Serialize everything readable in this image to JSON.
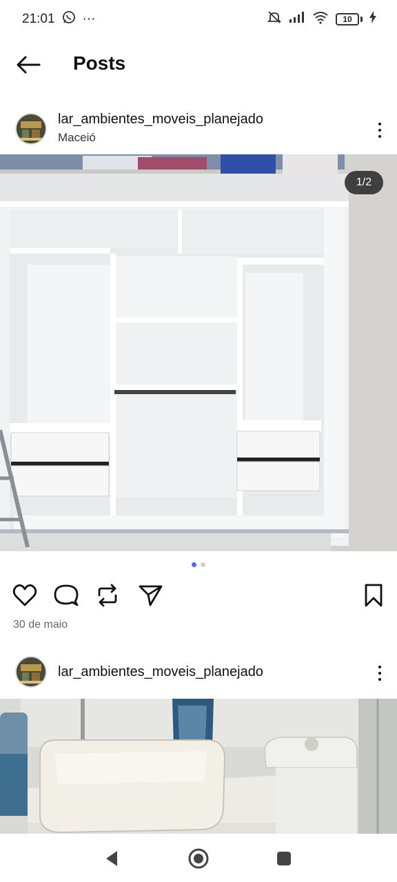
{
  "status_bar": {
    "time": "21:01",
    "more": "···",
    "battery_level": "10"
  },
  "header": {
    "title": "Posts"
  },
  "posts": [
    {
      "username": "lar_ambientes_moveis_planejado",
      "location": "Maceió",
      "image_counter": "1/2",
      "carousel_position": 1,
      "carousel_total": 2,
      "date": "30 de maio"
    },
    {
      "username": "lar_ambientes_moveis_planejado"
    }
  ],
  "icons": {
    "back": "arrow-left",
    "like": "heart-outline",
    "comment": "speech-bubble",
    "repost": "repost-arrows",
    "share": "paper-plane",
    "save": "bookmark-outline",
    "more": "vertical-ellipsis",
    "nav_back": "triangle-left",
    "nav_home": "circle-home",
    "nav_recents": "square-recents"
  },
  "colors": {
    "accent_dot": "#4a6cf7",
    "text_primary": "#111111",
    "text_secondary": "#666666"
  }
}
